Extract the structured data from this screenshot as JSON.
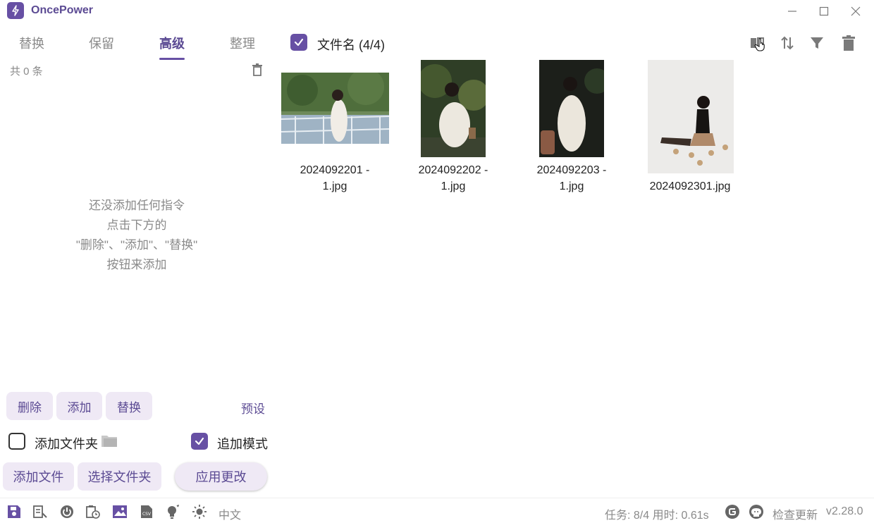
{
  "app": {
    "title": "OncePower"
  },
  "tabs": [
    {
      "label": "替换"
    },
    {
      "label": "保留"
    },
    {
      "label": "高级"
    },
    {
      "label": "整理"
    }
  ],
  "active_tab": "高级",
  "rules": {
    "count_label": "共 0 条",
    "empty_lines": [
      "还没添加任何指令",
      "点击下方的",
      "\"删除\"、\"添加\"、\"替换\"",
      "按钮来添加"
    ]
  },
  "actions": {
    "delete": "删除",
    "add": "添加",
    "replace": "替换",
    "preset": "预设"
  },
  "options": {
    "add_folder_label": "添加文件夹",
    "add_folder_checked": false,
    "append_mode_label": "追加模式",
    "append_mode_checked": true
  },
  "bottom_buttons": {
    "add_file": "添加文件",
    "select_folder": "选择文件夹",
    "apply": "应用更改"
  },
  "files_header": {
    "label": "文件名 (4/4)",
    "checked": true
  },
  "files": [
    {
      "name_line1": "2024092201 -",
      "name_line2": "1.jpg"
    },
    {
      "name_line1": "2024092202 -",
      "name_line2": "1.jpg"
    },
    {
      "name_line1": "2024092203 -",
      "name_line2": "1.jpg"
    },
    {
      "name_line1": "",
      "name_line2": "2024092301.jpg"
    }
  ],
  "status": {
    "language": "中文",
    "task_info": "任务: 8/4 用时: 0.61s",
    "check_update": "检查更新",
    "version": "v2.28.0"
  },
  "colors": {
    "accent": "#6750a4",
    "accent_text": "#5b4a93",
    "chip_bg": "#efe9f5",
    "muted": "#8a8a8a"
  }
}
